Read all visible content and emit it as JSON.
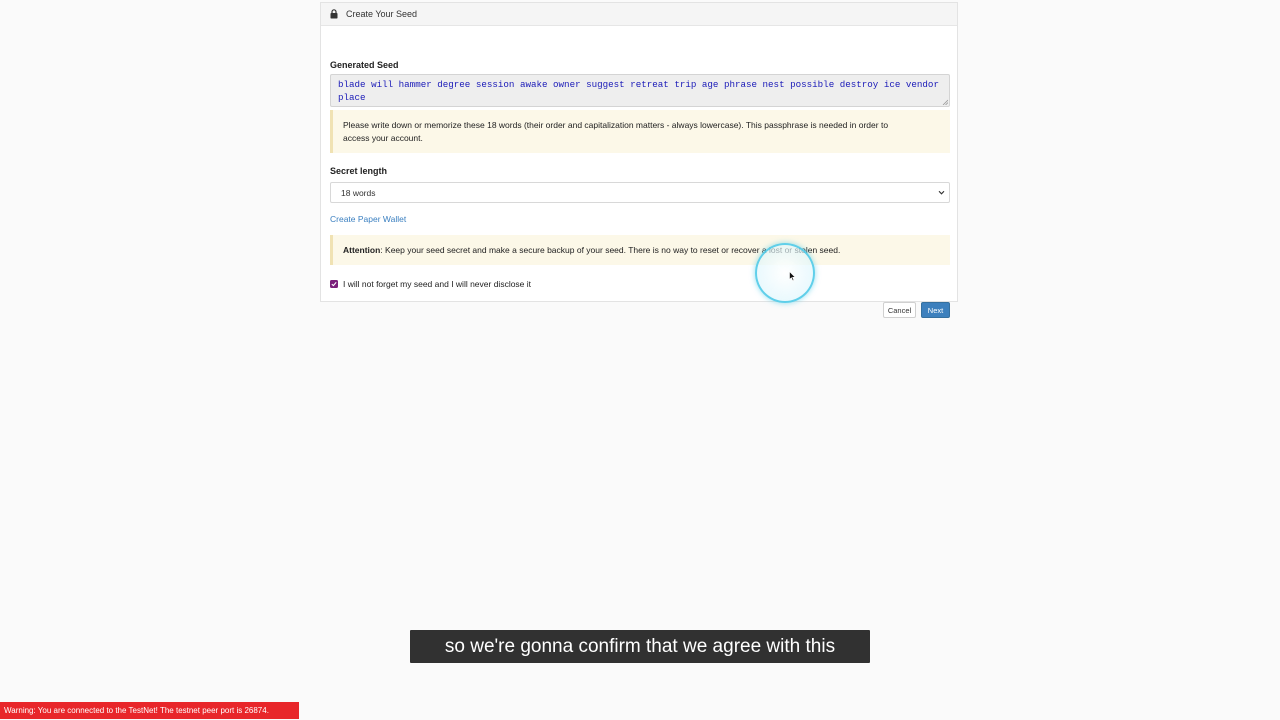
{
  "panel": {
    "title": "Create Your Seed",
    "header_icon": "lock-icon"
  },
  "generated_seed": {
    "label": "Generated Seed",
    "line1": "blade will hammer degree session awake owner suggest retreat trip age phrase nest possible destroy ice vendor",
    "line2": "place"
  },
  "note": {
    "line1": "Please write down or memorize these 18 words (their order and capitalization matters - always lowercase). This passphrase is needed in order to",
    "line2": "access your account."
  },
  "secret_length": {
    "label": "Secret length",
    "selected": "18 words"
  },
  "paper_wallet_link": "Create Paper Wallet",
  "attention": {
    "strong": "Attention",
    "text": ": Keep your seed secret and make a secure backup of your seed. There is no way to reset or recover a lost or stolen seed."
  },
  "confirm_checkbox": {
    "label": "I will not forget my seed and I will never disclose it",
    "checked": true
  },
  "buttons": {
    "cancel": "Cancel",
    "next": "Next"
  },
  "caption": "so we're gonna confirm that we agree with this",
  "warning": "Warning: You are connected to the TestNet! The testnet peer port is 26874.",
  "colors": {
    "accent": "#3d80bd",
    "link": "#3a7fc0",
    "seed_text": "#1a1ab8",
    "warning_bg": "#e8262a",
    "checkbox": "#7a1f7a",
    "note_bg": "#fcf8e8"
  }
}
